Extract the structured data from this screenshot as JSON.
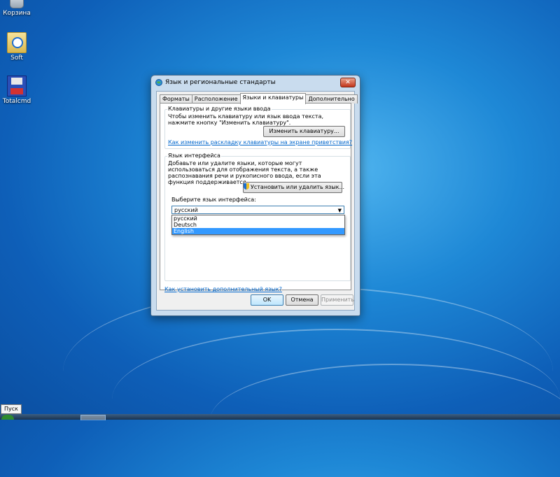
{
  "desktop": {
    "icons": [
      {
        "label": "Корзина",
        "icon": "recycle-bin-icon"
      },
      {
        "label": "Soft",
        "icon": "folder-icon"
      },
      {
        "label": "Totalcmd",
        "icon": "totalcmd-icon"
      }
    ]
  },
  "window": {
    "title": "Язык и региональные стандарты",
    "close_label": "✕",
    "tabs": [
      "Форматы",
      "Расположение",
      "Языки и клавиатуры",
      "Дополнительно"
    ],
    "active_tab": 2,
    "keyboards": {
      "group_title": "Клавиатуры и другие языки ввода",
      "description": "Чтобы изменить клавиатуру или язык ввода текста, нажмите кнопку \"Изменить клавиатуру\".",
      "change_button": "Изменить клавиатуру...",
      "welcome_link": "Как изменить раскладку клавиатуры на экране приветствия?"
    },
    "display_language": {
      "group_title": "Язык интерфейса",
      "description": "Добавьте или удалите языки, которые могут использоваться для отображения текста, а также распознавания речи и рукописного ввода, если эта функция поддерживается.",
      "install_button": "Установить или удалить язык...",
      "choose_label": "Выберите язык интерфейса:",
      "selected": "русский",
      "options": [
        "русский",
        "Deutsch",
        "English"
      ],
      "highlighted_index": 2
    },
    "additional_link": "Как установить дополнительный язык?",
    "buttons": {
      "ok": "OK",
      "cancel": "Отмена",
      "apply": "Применить"
    }
  },
  "taskbar": {
    "tooltip": "Пуск"
  }
}
